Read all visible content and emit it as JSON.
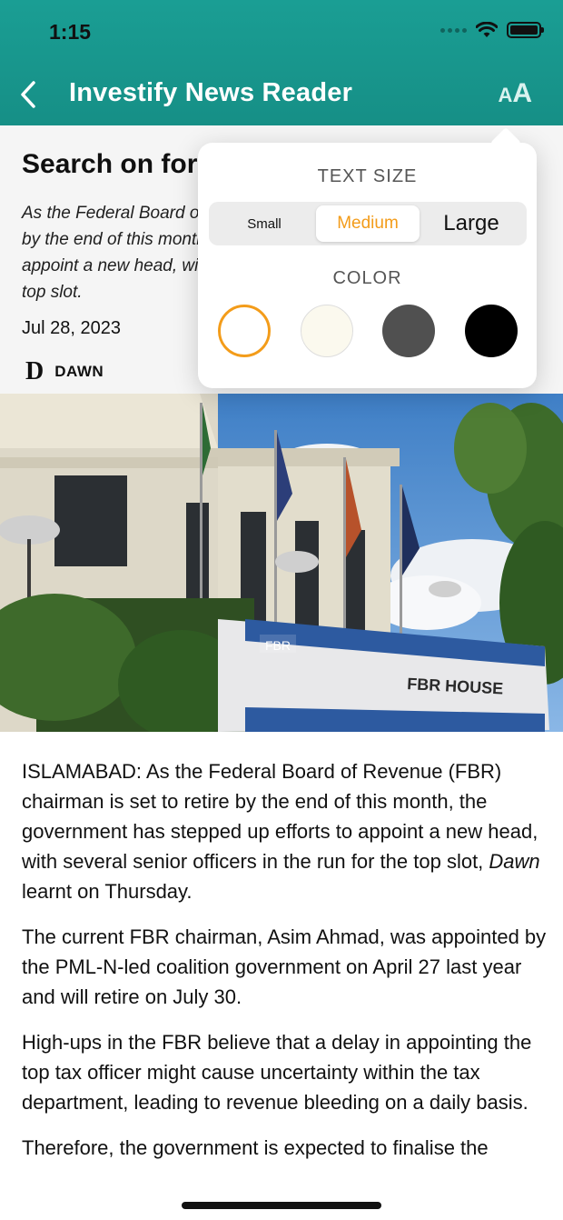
{
  "status_bar": {
    "time": "1:15"
  },
  "nav": {
    "title": "Investify News Reader",
    "text_size_button_small": "A",
    "text_size_button_large": "A"
  },
  "article": {
    "title": "Search on for new FBR chief",
    "summary": "As the Federal Board of Revenue (FBR) chairman is set to retire by the end of this month, the government has stepped up efforts to appoint a new head, with several senior officers in the run for the top slot.",
    "date": "Jul 28, 2023",
    "source_logo": "D",
    "source_name": "DAWN",
    "image_sign_logo": "FBR",
    "image_sign_text": "FBR HOUSE",
    "paragraphs": [
      [
        "ISLAMABAD: As the Federal Board of Revenue (FBR) chairman is set to retire by the end of this month, the government has stepped up efforts to appoint a new head, with several senior officers in the run for the top slot, ",
        "Dawn",
        " learnt on Thursday."
      ],
      [
        "The current FBR chairman, Asim Ahmad, was appointed by the PML-N-led coalition government on April 27 last year and will retire on July 30.",
        "",
        ""
      ],
      [
        "High-ups in the FBR believe that a delay in appointing the top tax officer might cause uncertainty within the tax department, leading to revenue bleeding on a daily basis.",
        "",
        ""
      ],
      [
        "Therefore, the government is expected to finalise the appointment before the incumbent retires.",
        "",
        ""
      ]
    ]
  },
  "popover": {
    "text_size_heading": "TEXT SIZE",
    "sizes": [
      "Small",
      "Medium",
      "Large"
    ],
    "selected_size": "Medium",
    "color_heading": "COLOR",
    "colors": [
      "#ffffff",
      "#fbf9ee",
      "#505050",
      "#000000"
    ],
    "selected_color": "#ffffff",
    "accent_color": "#f39c1a"
  },
  "theme": {
    "header_color": "#1a9e94"
  }
}
